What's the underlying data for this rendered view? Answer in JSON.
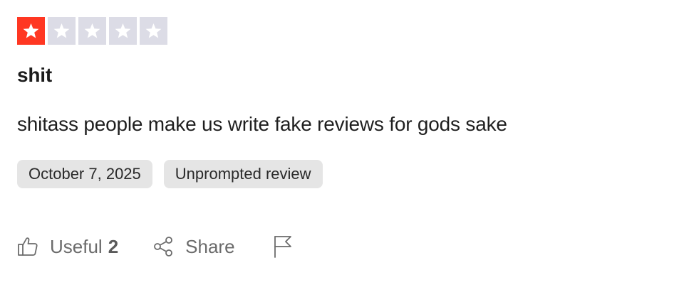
{
  "rating": {
    "value": 1,
    "max": 5,
    "filled_color": "#ff3722",
    "empty_color": "#dcdce6",
    "icon": "star-icon"
  },
  "review": {
    "title": "shit",
    "text": "shitass people make us write fake reviews for gods sake"
  },
  "chips": {
    "date": "October 7, 2025",
    "type": "Unprompted review"
  },
  "actions": {
    "useful_label": "Useful",
    "useful_count": "2",
    "useful_icon": "thumbs-up-icon",
    "share_label": "Share",
    "share_icon": "share-icon",
    "flag_icon": "flag-icon"
  }
}
